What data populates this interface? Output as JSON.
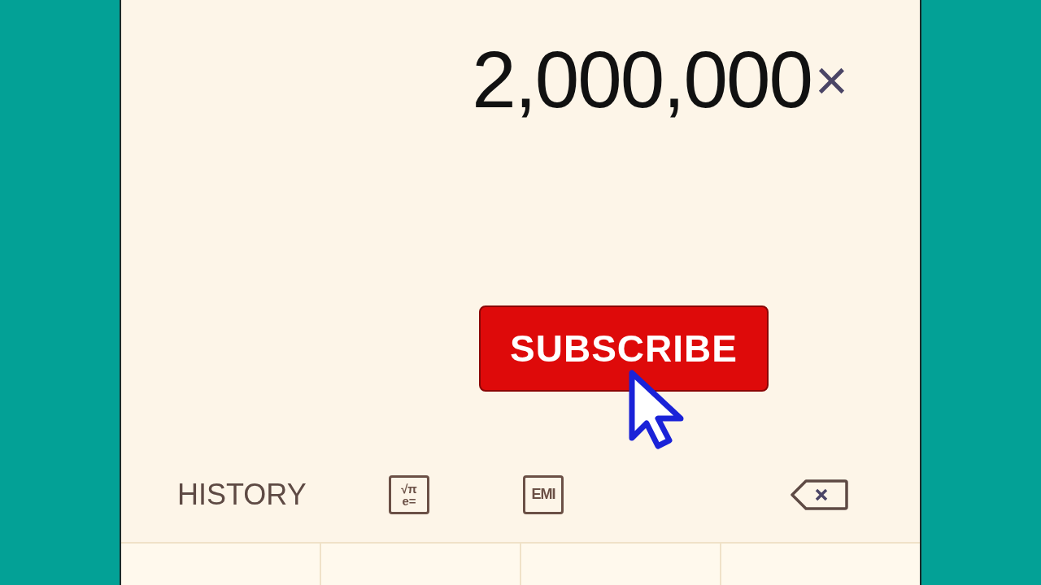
{
  "display": {
    "expression": "2,000,000",
    "operator": "×"
  },
  "overlay": {
    "label": "SUBSCRIBE"
  },
  "toolbar": {
    "history": "HISTORY",
    "scientific_icon": {
      "top": "√π",
      "bottom": "e="
    },
    "emi_icon": "EMI"
  }
}
